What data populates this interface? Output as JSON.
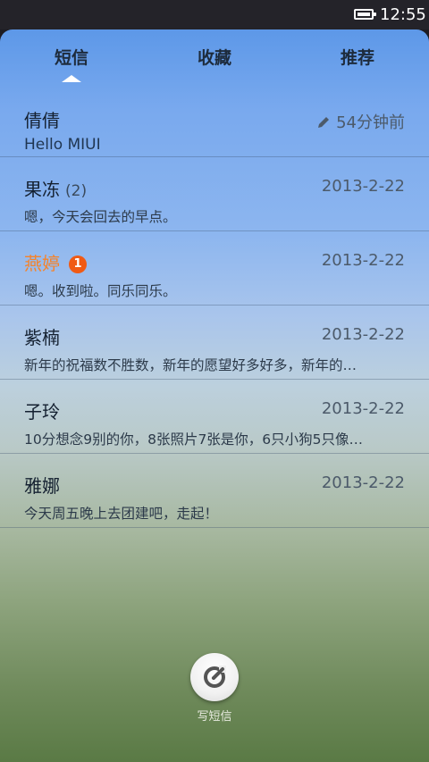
{
  "status_bar": {
    "time": "12:55"
  },
  "tabs": [
    {
      "label": "短信"
    },
    {
      "label": "收藏"
    },
    {
      "label": "推荐"
    }
  ],
  "conversations": [
    {
      "name": "倩倩",
      "count": "",
      "badge": "",
      "time": "54分钟前",
      "preview": "Hello MIUI"
    },
    {
      "name": "果冻",
      "count": "(2)",
      "badge": "",
      "time": "2013-2-22",
      "preview": "嗯，今天会回去的早点。"
    },
    {
      "name": "燕婷",
      "count": "",
      "badge": "1",
      "time": "2013-2-22",
      "preview": "嗯。收到啦。同乐同乐。"
    },
    {
      "name": "紫楠",
      "count": "",
      "badge": "",
      "time": "2013-2-22",
      "preview": "新年的祝福数不胜数，新年的愿望好多好多，新年的…"
    },
    {
      "name": "子玲",
      "count": "",
      "badge": "",
      "time": "2013-2-22",
      "preview": "10分想念9别的你，8张照片7张是你，6只小狗5只像…"
    },
    {
      "name": "雅娜",
      "count": "",
      "badge": "",
      "time": "2013-2-22",
      "preview": "今天周五晚上去团建吧，走起！"
    }
  ],
  "compose": {
    "label": "写短信",
    "icon": "compose-icon"
  },
  "colors": {
    "unread_name": "#f5832a",
    "badge": "#f05a14"
  }
}
